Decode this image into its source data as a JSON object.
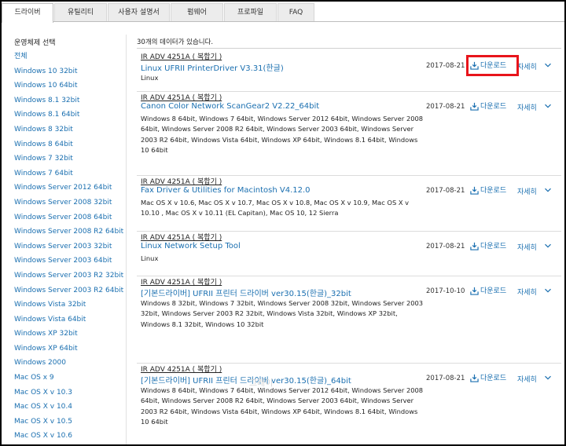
{
  "tabs": [
    "드라이버",
    "유틸리티",
    "사용자 설명서",
    "펌웨어",
    "프로파일",
    "FAQ"
  ],
  "sidebar": {
    "title": "운영체제 선택",
    "items": [
      "전체",
      "Windows 10 32bit",
      "Windows 10 64bit",
      "Windows 8.1 32bit",
      "Windows 8.1 64bit",
      "Windows 8 32bit",
      "Windows 8 64bit",
      "Windows 7 32bit",
      "Windows 7 64bit",
      "Windows Server 2012 64bit",
      "Windows Server 2008 32bit",
      "Windows Server 2008 64bit",
      "Windows Server 2008 R2 64bit",
      "Windows Server 2003 32bit",
      "Windows Server 2003 64bit",
      "Windows Server 2003 R2 32bit",
      "Windows Server 2003 R2 64bit",
      "Windows Vista 32bit",
      "Windows Vista 64bit",
      "Windows XP 32bit",
      "Windows XP 64bit",
      "Windows 2000",
      "Mac OS x 9",
      "Mac OS X v 10.3",
      "Mac OS X v 10.4",
      "Mac OS X v 10.5",
      "Mac OS X v 10.6"
    ]
  },
  "results": {
    "count_text": "30개의 데이터가 있습니다.",
    "download_label": "다운로드",
    "detail_label": "자세히",
    "rows": [
      {
        "model": "IR ADV 4251A ( 복합기 )",
        "title": "Linux UFRII PrinterDriver V3.31(한글)",
        "os": "Linux",
        "date": "2017-08-21"
      },
      {
        "model": "IR ADV 4251A ( 복합기 )",
        "title": "Canon Color Network ScanGear2 V2.22_64bit",
        "os": "Windows 8 64bit, Windows 7 64bit, Windows Server 2012 64bit, Windows Server 2008 64bit, Windows Server 2008 R2 64bit, Windows Server 2003 64bit, Windows Server 2003 R2 64bit, Windows Vista 64bit, Windows XP 64bit, Windows 8.1 64bit, Windows 10 64bit",
        "date": "2017-08-21"
      },
      {
        "model": "IR ADV 4251A ( 복합기 )",
        "title": "Fax Driver & Utilities for Macintosh V4.12.0",
        "os": "Mac OS X v 10.6, Mac OS X v 10.7, Mac OS X v 10.8, Mac OS X v 10.9, Mac OS X v 10.10 , Mac OS X v 10.11 (EL Capitan), Mac OS 10, 12 Sierra",
        "date": "2017-08-21"
      },
      {
        "model": "IR ADV 4251A ( 복합기 )",
        "title": "Linux Network Setup Tool",
        "os": "Linux",
        "date": "2017-08-21"
      },
      {
        "model": "IR ADV 4251A ( 복합기 )",
        "title": "[기본드라이버] UFRII 프린터 드라이버 ver30.15(한글)_32bit",
        "os": "Windows 8 32bit, Windows 7 32bit, Windows Server 2008 32bit, Windows Server 2003 32bit, Windows Server 2003 R2 32bit, Windows Vista 32bit, Windows XP 32bit, Windows 8.1 32bit, Windows 10 32bit",
        "date": "2017-10-10"
      },
      {
        "model": "IR ADV 4251A ( 복합기 )",
        "title": "[기본드라이버] UFRII 프린터 드라이버 ver30.15(한글)_64bit",
        "os": "Windows 8 64bit, Windows 7 64bit, Windows Server 2012 64bit, Windows Server 2008 64bit, Windows Server 2008 R2 64bit, Windows Server 2003 64bit, Windows Server 2003 R2 64bit, Windows Vista 64bit, Windows XP 64bit, Windows 8.1 64bit, Windows 10 64bit",
        "date": "2017-08-21"
      }
    ]
  },
  "colors": {
    "link": "#1a6fb0",
    "highlight": "#e8141b"
  }
}
